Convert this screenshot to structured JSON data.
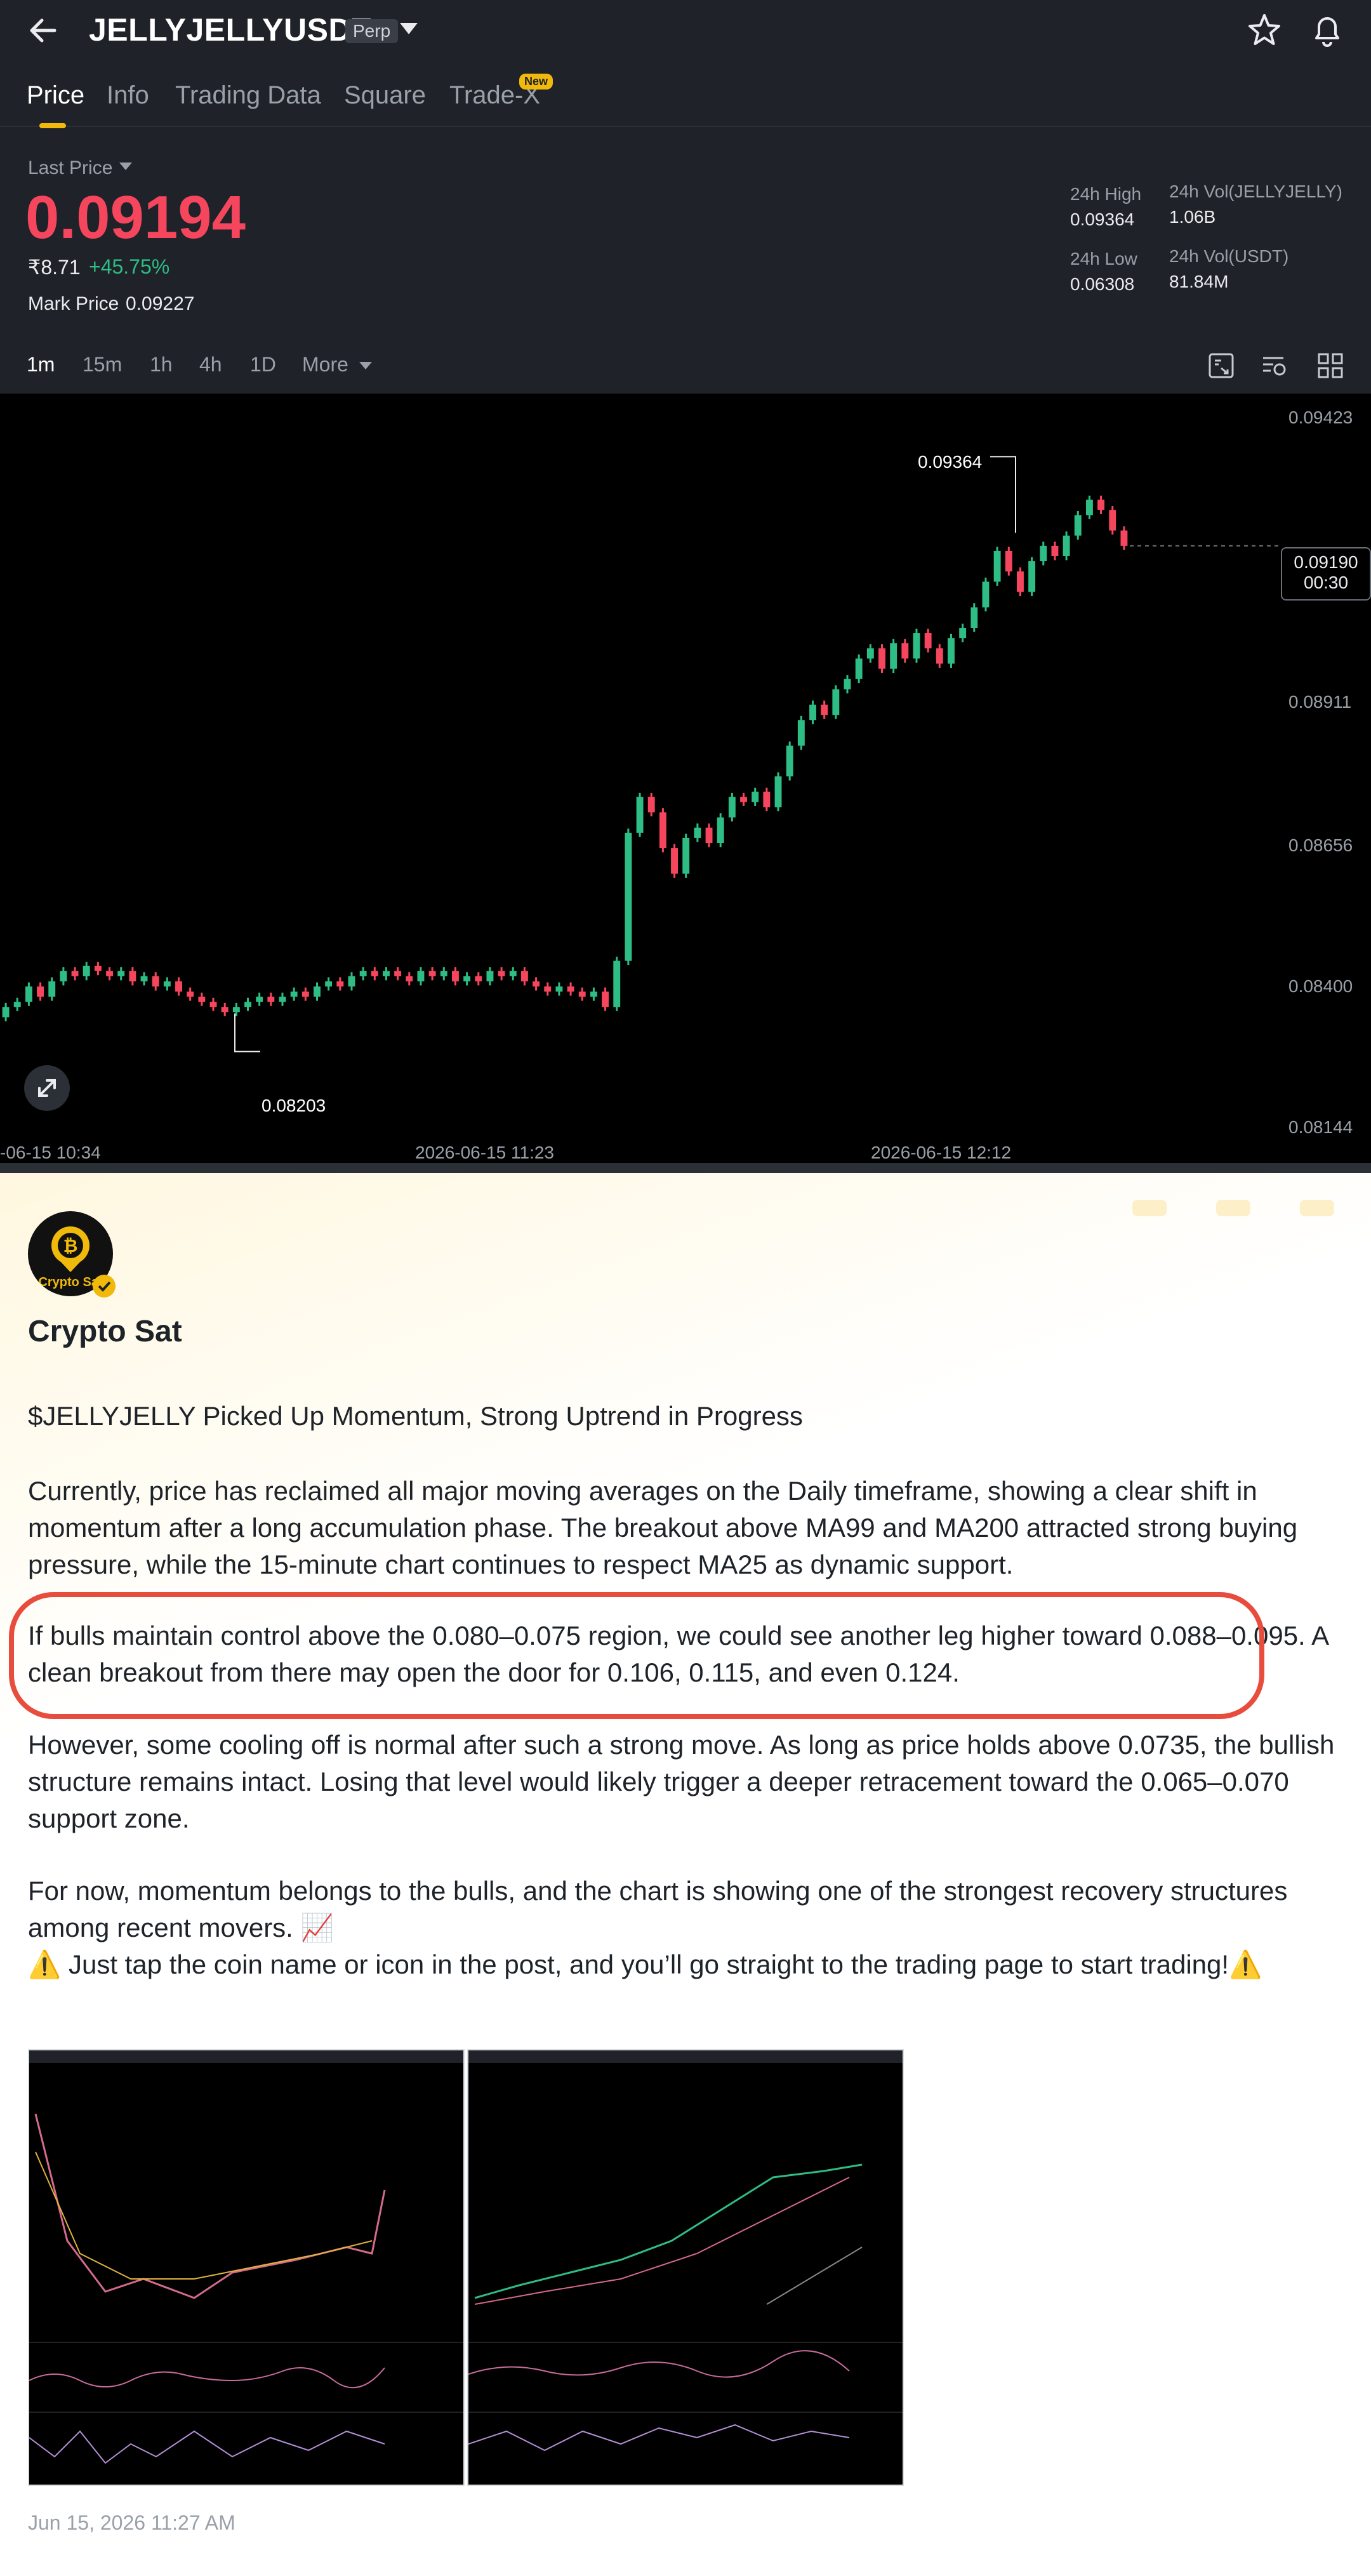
{
  "header": {
    "pair": "JELLYJELLYUSDT",
    "badge": "Perp"
  },
  "tabs": [
    {
      "label": "Price"
    },
    {
      "label": "Info"
    },
    {
      "label": "Trading Data"
    },
    {
      "label": "Square"
    },
    {
      "label": "Trade-X"
    }
  ],
  "new_badge": "New",
  "price": {
    "last_label": "Last Price",
    "last_value": "0.09194",
    "fiat_value": "₹8.71",
    "change": "+45.75%",
    "mark_label": "Mark Price",
    "mark_value": "0.09227"
  },
  "stats": {
    "high_label": "24h High",
    "high_value": "0.09364",
    "low_label": "24h Low",
    "low_value": "0.06308",
    "vol_base_label": "24h Vol(JELLYJELLY)",
    "vol_base_value": "1.06B",
    "vol_quote_label": "24h Vol(USDT)",
    "vol_quote_value": "81.84M"
  },
  "intervals": [
    {
      "label": "1m"
    },
    {
      "label": "15m"
    },
    {
      "label": "1h"
    },
    {
      "label": "4h"
    },
    {
      "label": "1D"
    },
    {
      "label": "More"
    }
  ],
  "chart": {
    "y_ticks": [
      "0.09423",
      "0.08911",
      "0.08656",
      "0.08400",
      "0.08144"
    ],
    "x_ticks": [
      "-06-15 10:34",
      "2026-06-15 11:23",
      "2026-06-15 12:12"
    ],
    "high_marker": "0.09364",
    "low_marker": "0.08203",
    "current_price": "0.09190",
    "countdown": "00:30"
  },
  "chart_data": {
    "type": "candlestick",
    "y_axis_min": 0.0805,
    "y_axis_max": 0.0945,
    "current_price": 0.0919,
    "high": 0.09364,
    "low": 0.08203,
    "close": [
      0.0829,
      0.083,
      0.0833,
      0.0831,
      0.0834,
      0.0836,
      0.0835,
      0.0837,
      0.0836,
      0.0835,
      0.0836,
      0.0834,
      0.0835,
      0.0833,
      0.0834,
      0.0832,
      0.0831,
      0.083,
      0.0829,
      0.0828,
      0.0829,
      0.083,
      0.0831,
      0.083,
      0.0831,
      0.0832,
      0.0831,
      0.0833,
      0.0834,
      0.0833,
      0.0835,
      0.0836,
      0.0835,
      0.0836,
      0.0835,
      0.0834,
      0.0836,
      0.0835,
      0.0836,
      0.0834,
      0.0835,
      0.0834,
      0.0836,
      0.0835,
      0.0836,
      0.0834,
      0.0833,
      0.0832,
      0.0833,
      0.0832,
      0.0831,
      0.0832,
      0.0829,
      0.0838,
      0.0863,
      0.087,
      0.0867,
      0.086,
      0.0855,
      0.0862,
      0.0864,
      0.0861,
      0.0866,
      0.087,
      0.0869,
      0.0871,
      0.0868,
      0.0874,
      0.088,
      0.0885,
      0.0888,
      0.0886,
      0.0891,
      0.0893,
      0.0897,
      0.0899,
      0.0895,
      0.09,
      0.0897,
      0.0902,
      0.0899,
      0.0896,
      0.0901,
      0.0903,
      0.0907,
      0.0912,
      0.0918,
      0.0914,
      0.091,
      0.0916,
      0.0919,
      0.0917,
      0.0921,
      0.0925,
      0.0928,
      0.0926,
      0.0922,
      0.0919
    ]
  },
  "post": {
    "author": "Crypto Sat",
    "avatar_text": "Crypto Sat",
    "title": "$JELLYJELLY Picked Up Momentum, Strong Uptrend in Progress",
    "p1": "Currently, price has reclaimed all major moving averages on the Daily timeframe, showing a clear shift in momentum after a long accumulation phase. The breakout above MA99 and MA200 attracted strong buying pressure, while the 15-minute chart continues to respect MA25 as dynamic support.",
    "p2": "If bulls maintain control above the 0.080–0.075 region, we could see another leg higher toward 0.088–0.095. A clean breakout from there may open the door for 0.106, 0.115, and even 0.124.",
    "p3": "However, some cooling off is normal after such a strong move. As long as price holds above 0.0735, the bullish structure remains intact. Losing that level would likely trigger a deeper retracement toward the 0.065–0.070 support zone.",
    "p4": "For now, momentum belongs to the bulls, and the chart is showing one of the strongest recovery structures among recent movers. 📈",
    "p5": "⚠️ Just tap the coin name or icon in the post, and you’ll go straight to the trading page to start trading!⚠️",
    "date": "Jun 15, 2026 11:27 AM"
  },
  "colors": {
    "up": "#2ebd85",
    "down": "#f6465d",
    "accent": "#f0b90b",
    "highlight_ring": "#e84c3d"
  }
}
